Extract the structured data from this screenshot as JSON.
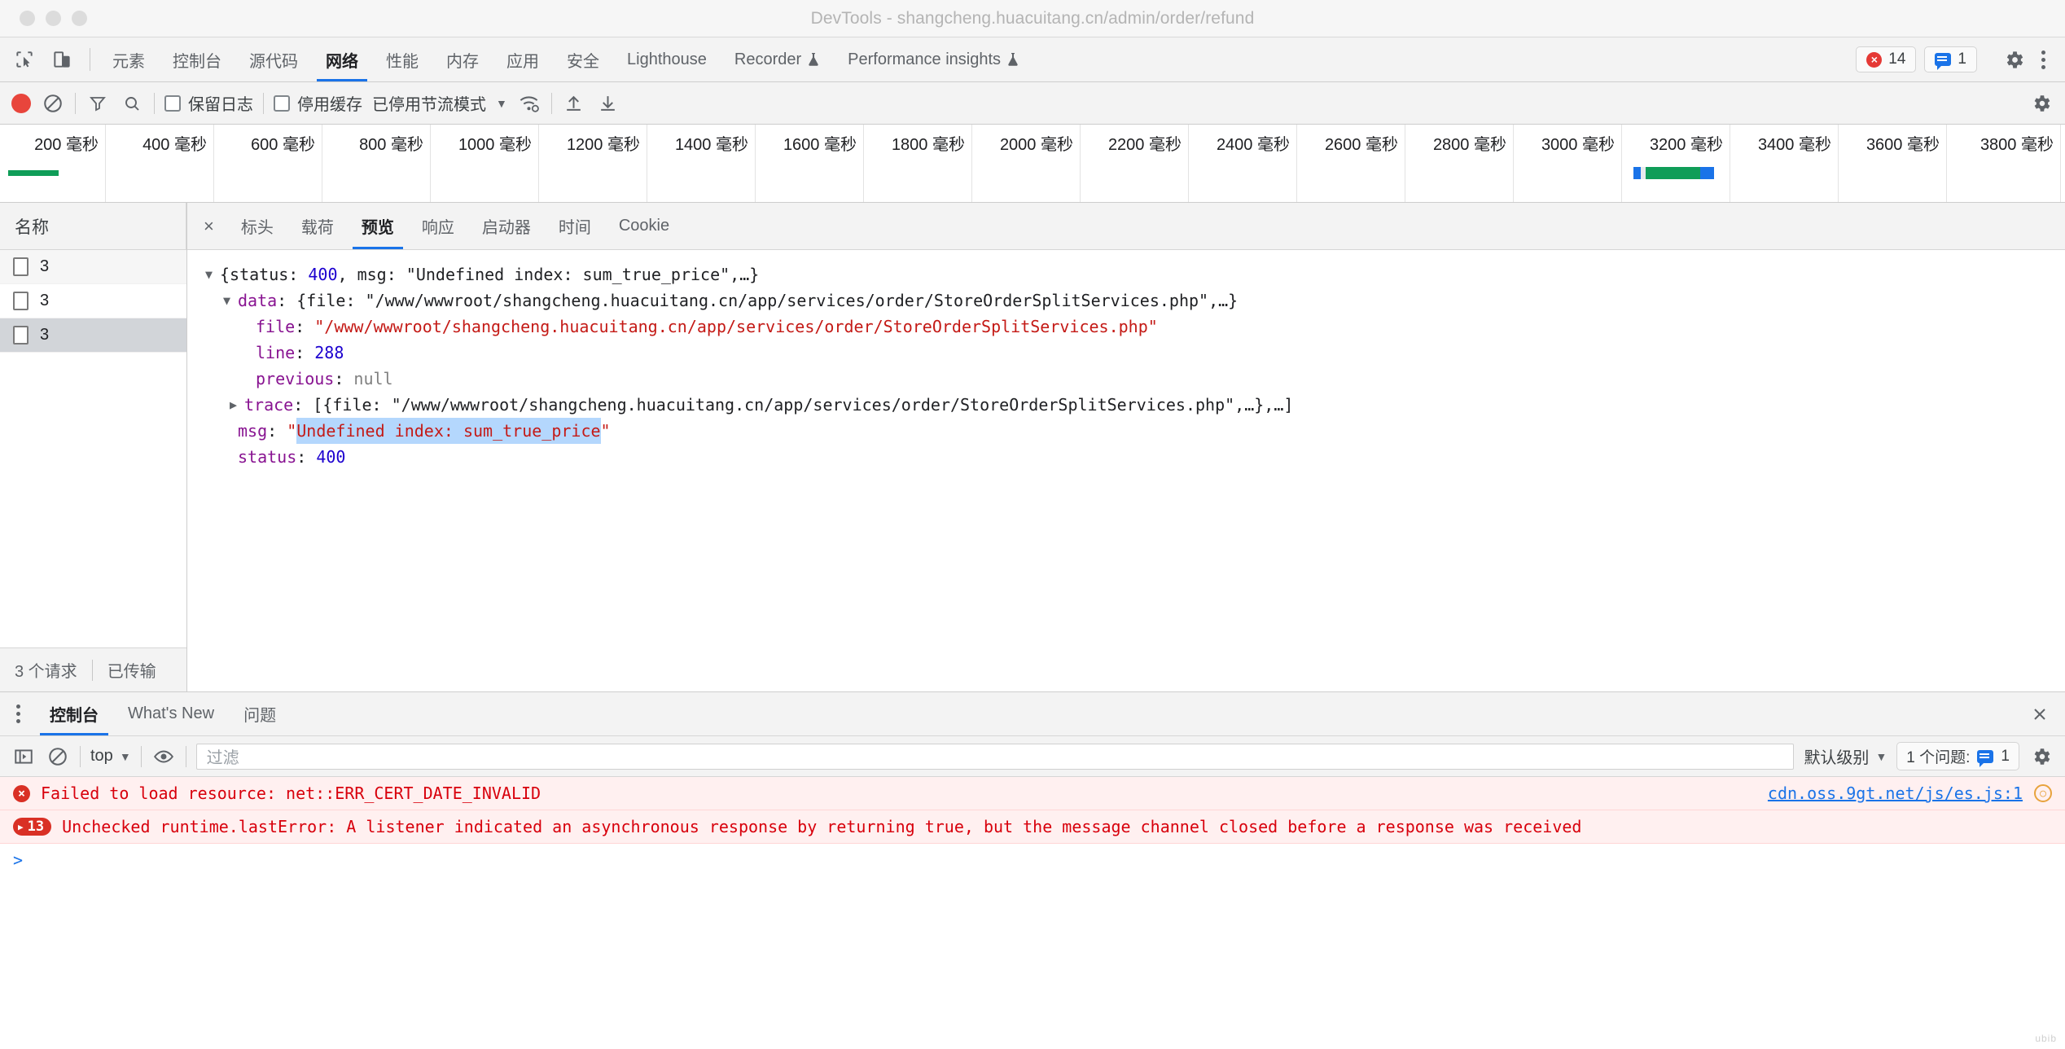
{
  "window": {
    "title": "DevTools - shangcheng.huacuitang.cn/admin/order/refund"
  },
  "main_tabs": {
    "items": [
      {
        "label": "元素",
        "active": false
      },
      {
        "label": "控制台",
        "active": false
      },
      {
        "label": "源代码",
        "active": false
      },
      {
        "label": "网络",
        "active": true
      },
      {
        "label": "性能",
        "active": false
      },
      {
        "label": "内存",
        "active": false
      },
      {
        "label": "应用",
        "active": false
      },
      {
        "label": "安全",
        "active": false
      },
      {
        "label": "Lighthouse",
        "active": false
      },
      {
        "label": "Recorder",
        "active": false,
        "flask": "⚗"
      },
      {
        "label": "Performance insights",
        "active": false,
        "flask": "⚗"
      }
    ],
    "error_count": "14",
    "message_count": "1"
  },
  "network_toolbar": {
    "preserve_log": "保留日志",
    "disable_cache": "停用缓存",
    "throttle": "已停用节流模式"
  },
  "timeline": {
    "unit": "毫秒",
    "ticks": [
      "200 毫秒",
      "400 毫秒",
      "600 毫秒",
      "800 毫秒",
      "1000 毫秒",
      "1200 毫秒",
      "1400 毫秒",
      "1600 毫秒",
      "1800 毫秒",
      "2000 毫秒",
      "2200 毫秒",
      "2400 毫秒",
      "2600 毫秒",
      "2800 毫秒",
      "3000 毫秒",
      "3200 毫秒",
      "3400 毫秒",
      "3600 毫秒",
      "3800 毫秒"
    ]
  },
  "request_panel": {
    "column_header": "名称",
    "rows": [
      {
        "name": "3",
        "selected": false
      },
      {
        "name": "3",
        "selected": false
      },
      {
        "name": "3",
        "selected": true
      }
    ],
    "footer_requests": "3 个请求",
    "footer_transferred": "已传输"
  },
  "detail_tabs": {
    "close": "×",
    "items": [
      {
        "label": "标头",
        "active": false
      },
      {
        "label": "载荷",
        "active": false
      },
      {
        "label": "预览",
        "active": true
      },
      {
        "label": "响应",
        "active": false
      },
      {
        "label": "启动器",
        "active": false
      },
      {
        "label": "时间",
        "active": false
      },
      {
        "label": "Cookie",
        "active": false
      }
    ]
  },
  "preview_json": {
    "root_prefix": "{status: ",
    "root_status": "400",
    "root_mid": ", msg: ",
    "root_msg": "\"Undefined index: sum_true_price\"",
    "root_suffix": ",…}",
    "data_key": "data",
    "data_open": ": {file: ",
    "data_file": "\"/www/wwwroot/shangcheng.huacuitang.cn/app/services/order/StoreOrderSplitServices.php\"",
    "data_close": ",…}",
    "file_key": "file",
    "file_value": "\"/www/wwwroot/shangcheng.huacuitang.cn/app/services/order/StoreOrderSplitServices.php\"",
    "line_key": "line",
    "line_value": "288",
    "previous_key": "previous",
    "previous_value": "null",
    "trace_key": "trace",
    "trace_open": ": [{file: ",
    "trace_file": "\"/www/wwwroot/shangcheng.huacuitang.cn/app/services/order/StoreOrderSplitServices.php\"",
    "trace_close": ",…},…]",
    "msg_key": "msg",
    "msg_quote_open": "\"",
    "msg_value": "Undefined index: sum_true_price",
    "msg_quote_close": "\"",
    "status_key": "status",
    "status_value": "400"
  },
  "drawer": {
    "tabs": [
      {
        "label": "控制台",
        "active": true
      },
      {
        "label": "What's New",
        "active": false
      },
      {
        "label": "问题",
        "active": false
      }
    ],
    "context": "top",
    "filter_placeholder": "过滤",
    "level": "默认级别",
    "issues_label": "1 个问题:",
    "issues_count": "1"
  },
  "console_messages": [
    {
      "type": "error",
      "icon": "error-circle-icon",
      "text": "Failed to load resource: net::ERR_CERT_DATE_INVALID",
      "source": "cdn.oss.9gt.net/js/es.js:1"
    },
    {
      "type": "error-group",
      "count": "13",
      "text": "Unchecked runtime.lastError: A listener indicated an asynchronous response by returning true, but the message channel closed before a response was received",
      "source": ""
    }
  ],
  "prompt_symbol": ">"
}
